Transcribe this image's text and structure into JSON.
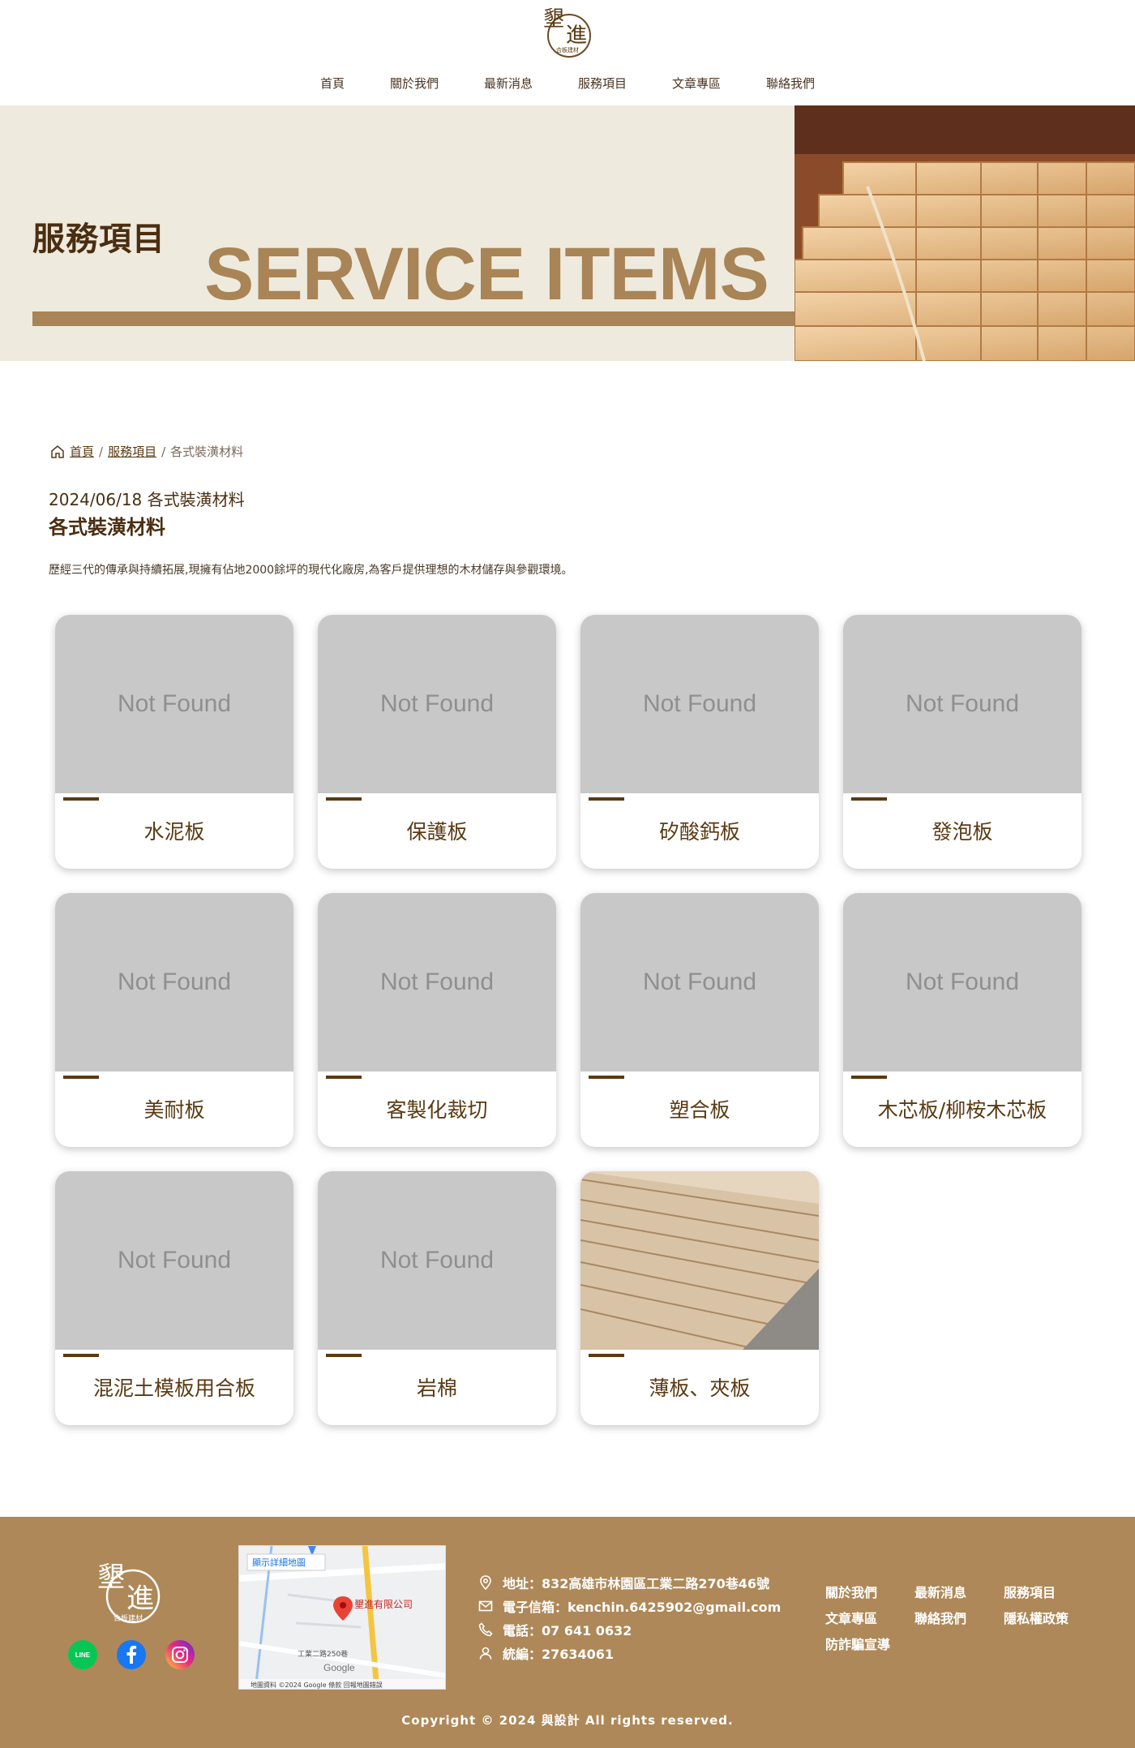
{
  "brand": {
    "logo_text": "墾進",
    "logo_subtext": "合板建材"
  },
  "nav": [
    {
      "label": "首頁"
    },
    {
      "label": "關於我們"
    },
    {
      "label": "最新消息"
    },
    {
      "label": "服務項目"
    },
    {
      "label": "文章專區"
    },
    {
      "label": "聯絡我們"
    }
  ],
  "hero": {
    "title_zh": "服務項目",
    "title_en": "SERVICE ITEMS"
  },
  "breadcrumb": {
    "home": "首頁",
    "sep1": "/",
    "section": "服務項目",
    "sep2": "/",
    "current": "各式裝潢材料"
  },
  "post": {
    "date_line": "2024/06/18 各式裝潢材料",
    "title": "各式裝潢材料",
    "description": "歷經三代的傳承與持續拓展,現擁有佔地2000餘坪的現代化廠房,為客戶提供理想的木材儲存與參觀環境。"
  },
  "products": [
    {
      "label": "水泥板",
      "image": "Not Found"
    },
    {
      "label": "保護板",
      "image": "Not Found"
    },
    {
      "label": "矽酸鈣板",
      "image": "Not Found"
    },
    {
      "label": "發泡板",
      "image": "Not Found"
    },
    {
      "label": "美耐板",
      "image": "Not Found"
    },
    {
      "label": "客製化裁切",
      "image": "Not Found"
    },
    {
      "label": "塑合板",
      "image": "Not Found"
    },
    {
      "label": "木芯板/柳桉木芯板",
      "image": "Not Found"
    },
    {
      "label": "混泥土模板用合板",
      "image": "Not Found"
    },
    {
      "label": "岩棉",
      "image": "Not Found"
    },
    {
      "label": "薄板、夾板",
      "image": ""
    }
  ],
  "footer": {
    "map": {
      "view_larger": "顯示詳細地圖",
      "pin_label": "墾進有限公司",
      "road": "工業二路250巷",
      "google": "Google",
      "attribution": "地圖資料 ©2024 Google   條款   回報地圖錯誤"
    },
    "contact": {
      "address": "地址：832高雄市林園區工業二路270巷46號",
      "email": "電子信箱：kenchin.6425902@gmail.com",
      "phone": "電話：07 641 0632",
      "tax_id": "統編：27634061"
    },
    "links": [
      "關於我們",
      "最新消息",
      "服務項目",
      "文章專區",
      "聯絡我們",
      "隱私權政策",
      "防詐騙宣導"
    ],
    "social": {
      "line": "LINE"
    },
    "copyright": "Copyright © 2024 與設計 All rights reserved."
  },
  "colors": {
    "brand_brown": "#5a3a12",
    "gold": "#a88456",
    "hero_bg": "#efeade",
    "footer_bg": "#ae8858",
    "placeholder_gray": "#c8c8c8"
  }
}
